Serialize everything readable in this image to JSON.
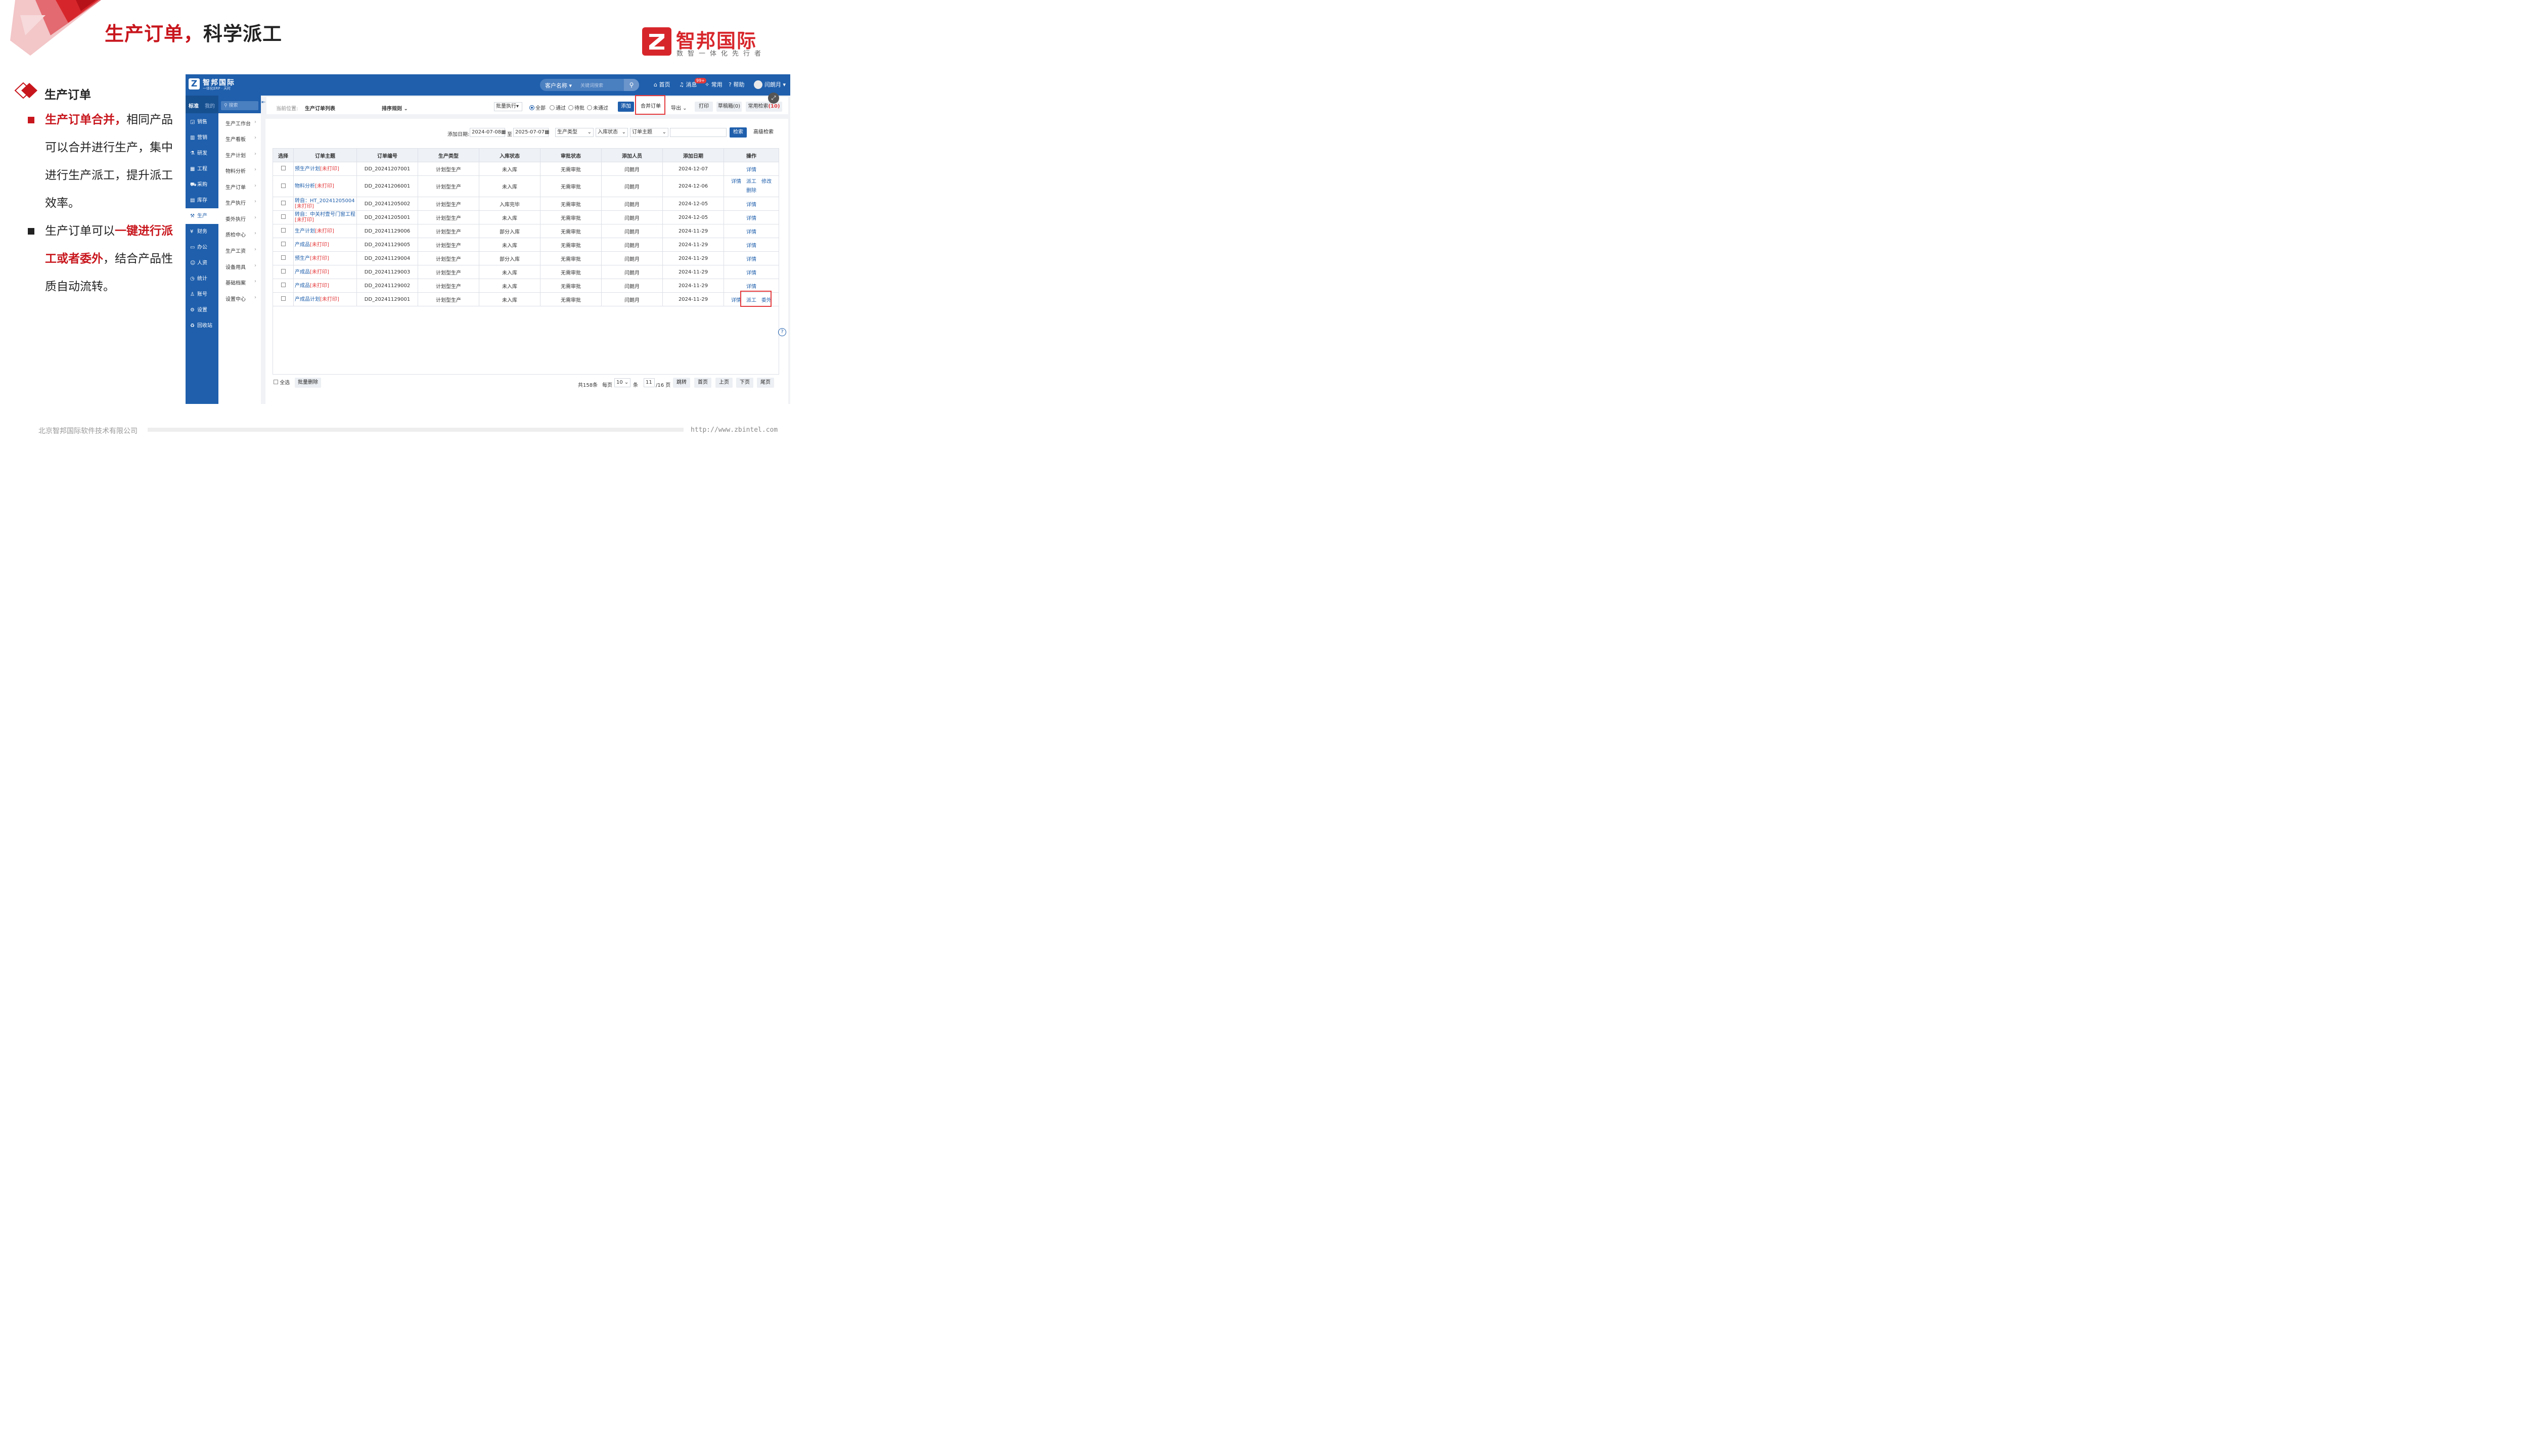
{
  "slide": {
    "title_red": "生产订单，",
    "title_black": "科学派工",
    "logo_name": "智邦国际",
    "logo_slogan": "数智一体化先行者",
    "section_title": "生产订单",
    "bullet1_red": "生产订单合并，",
    "bullet1_text": "相同产品可以合并进行生产，集中进行生产派工，提升派工效率。",
    "bullet2_text_a": "生产订单可以",
    "bullet2_red": "一键进行派工或者委外",
    "bullet2_text_b": "，结合产品性质自动流转。",
    "footer_company": "北京智邦国际软件技术有限公司",
    "footer_url": "http://www.zbintel.com",
    "colors": {
      "accent": "#c8161d",
      "erp_blue": "#1f5fac"
    }
  },
  "erp": {
    "brand": "智邦国际",
    "brand_sub": "一体化ERP · 天时",
    "search_scope": "客户名称",
    "search_placeholder": "关键词搜索",
    "nav": {
      "home": "首页",
      "messages": "消息",
      "messages_badge": "99+",
      "common": "常用",
      "help": "帮助",
      "user": "闫朗月"
    },
    "sidebar_tabs": [
      "标准",
      "我的"
    ],
    "sidebar": [
      {
        "icon": "chart-icon",
        "label": "销售"
      },
      {
        "icon": "bar-icon",
        "label": "营销"
      },
      {
        "icon": "flask-icon",
        "label": "研发"
      },
      {
        "icon": "grid-icon",
        "label": "工程"
      },
      {
        "icon": "cart-icon",
        "label": "采购"
      },
      {
        "icon": "box-icon",
        "label": "库存"
      },
      {
        "icon": "production-icon",
        "label": "生产"
      },
      {
        "icon": "money-icon",
        "label": "财务"
      },
      {
        "icon": "office-icon",
        "label": "办公"
      },
      {
        "icon": "people-icon",
        "label": "人资"
      },
      {
        "icon": "clock-icon",
        "label": "统计"
      },
      {
        "icon": "person-icon",
        "label": "账号"
      },
      {
        "icon": "gear-icon",
        "label": "设置"
      },
      {
        "icon": "trash-icon",
        "label": "回收站"
      }
    ],
    "sub_search": "搜索",
    "submenu": [
      "生产工作台",
      "生产看板",
      "生产计划",
      "物料分析",
      "生产订单",
      "生产执行",
      "委外执行",
      "质检中心",
      "生产工资",
      "设备用具",
      "基础档案",
      "设置中心"
    ],
    "crumb_prefix": "当前位置:",
    "crumb_page": "生产订单列表",
    "sort_label": "排序规则",
    "batch_exec": "批量执行",
    "filters": [
      "全部",
      "通过",
      "待批",
      "未通过"
    ],
    "toolbar": {
      "add": "添加",
      "merge": "合并订单",
      "export": "导出",
      "print": "打印",
      "draft": "草稿箱(0)",
      "common_search": "常用检索",
      "common_search_count": "(10)"
    },
    "search": {
      "date_label": "添加日期:",
      "date_from": "2024-07-08",
      "to": "至",
      "date_to": "2025-07-07",
      "type": "生产类型",
      "stock": "入库状态",
      "topic": "订单主题",
      "search_btn": "检索",
      "adv_btn": "高级检索"
    },
    "columns": [
      "选择",
      "订单主题",
      "订单编号",
      "生产类型",
      "入库状态",
      "审批状态",
      "添加人员",
      "添加日期",
      "操作"
    ],
    "rows": [
      {
        "topic": "预生产计划",
        "tag": "[未打印]",
        "no": "DD_20241207001",
        "type": "计划型生产",
        "stock": "未入库",
        "approve": "无需审批",
        "user": "闫朗月",
        "date": "2024-12-07",
        "ops": [
          "详情"
        ]
      },
      {
        "topic": "物料分析",
        "tag": "[未打印]",
        "no": "DD_20241206001",
        "type": "计划型生产",
        "stock": "未入库",
        "approve": "无需审批",
        "user": "闫朗月",
        "date": "2024-12-06",
        "ops": [
          "详情",
          "派工",
          "修改",
          "删除"
        ]
      },
      {
        "topic": "转自：HT_20241205004",
        "tag": "[未打印]",
        "no": "DD_20241205002",
        "type": "计划型生产",
        "stock": "入库完毕",
        "approve": "无需审批",
        "user": "闫朗月",
        "date": "2024-12-05",
        "ops": [
          "详情"
        ]
      },
      {
        "topic": "转自：中关村壹号门窗工程",
        "tag": "[未打印]",
        "no": "DD_20241205001",
        "type": "计划型生产",
        "stock": "未入库",
        "approve": "无需审批",
        "user": "闫朗月",
        "date": "2024-12-05",
        "ops": [
          "详情"
        ]
      },
      {
        "topic": "生产计划",
        "tag": "[未打印]",
        "no": "DD_20241129006",
        "type": "计划型生产",
        "stock": "部分入库",
        "approve": "无需审批",
        "user": "闫朗月",
        "date": "2024-11-29",
        "ops": [
          "详情"
        ]
      },
      {
        "topic": "产成品",
        "tag": "[未打印]",
        "no": "DD_20241129005",
        "type": "计划型生产",
        "stock": "未入库",
        "approve": "无需审批",
        "user": "闫朗月",
        "date": "2024-11-29",
        "ops": [
          "详情"
        ]
      },
      {
        "topic": "预生产",
        "tag": "[未打印]",
        "no": "DD_20241129004",
        "type": "计划型生产",
        "stock": "部分入库",
        "approve": "无需审批",
        "user": "闫朗月",
        "date": "2024-11-29",
        "ops": [
          "详情"
        ]
      },
      {
        "topic": "产成品",
        "tag": "[未打印]",
        "no": "DD_20241129003",
        "type": "计划型生产",
        "stock": "未入库",
        "approve": "无需审批",
        "user": "闫朗月",
        "date": "2024-11-29",
        "ops": [
          "详情"
        ]
      },
      {
        "topic": "产成品",
        "tag": "[未打印]",
        "no": "DD_20241129002",
        "type": "计划型生产",
        "stock": "未入库",
        "approve": "无需审批",
        "user": "闫朗月",
        "date": "2024-11-29",
        "ops": [
          "详情"
        ]
      },
      {
        "topic": "产成品计划",
        "tag": "[未打印]",
        "no": "DD_20241129001",
        "type": "计划型生产",
        "stock": "未入库",
        "approve": "无需审批",
        "user": "闫朗月",
        "date": "2024-11-29",
        "ops": [
          "详情",
          "派工",
          "委外"
        ]
      }
    ],
    "footer": {
      "select_all": "全选",
      "batch_delete": "批量删除",
      "total": "共158条",
      "per_page_label": "每页",
      "per_page": "10",
      "unit": "条",
      "page": "11",
      "pages": "/16 页",
      "jump": "跳转",
      "first": "首页",
      "prev": "上页",
      "next": "下页",
      "last": "尾页"
    }
  }
}
